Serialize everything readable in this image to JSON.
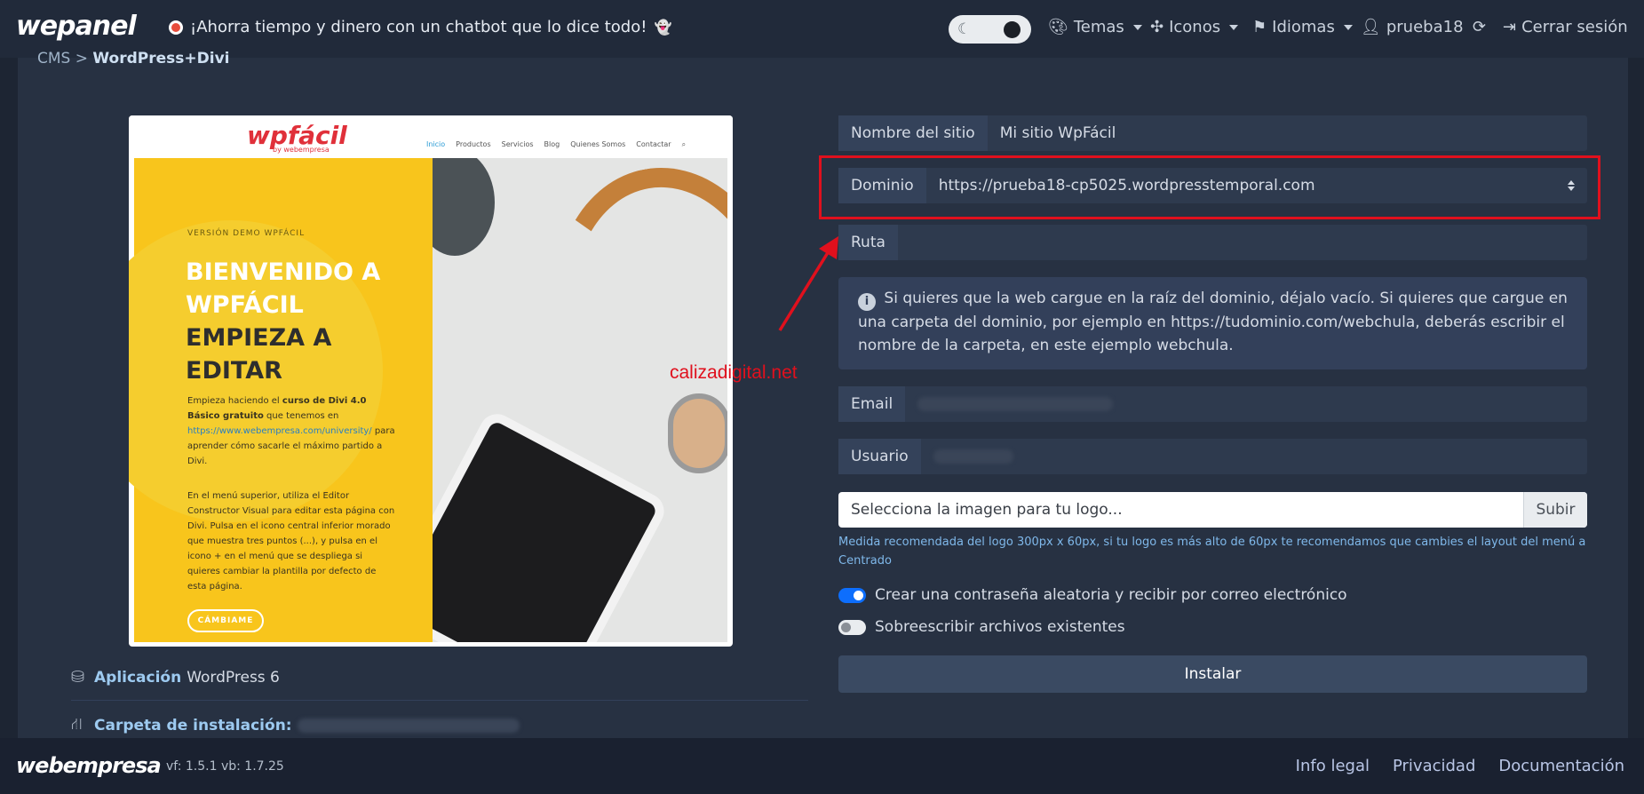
{
  "header": {
    "brand": "wepanel",
    "promo": "¡Ahorra tiempo y dinero con un chatbot que lo dice todo!",
    "promo_emoji": "👻",
    "nav": {
      "temas": "Temas",
      "iconos": "Iconos",
      "idiomas": "Idiomas",
      "user": "prueba18",
      "logout": "Cerrar sesión"
    }
  },
  "breadcrumb": {
    "section": "CMS",
    "separator": ">",
    "current": "WordPress+Divi"
  },
  "preview": {
    "logo": "wpfácil",
    "logo_sub": "by webempresa",
    "menu": [
      "Inicio",
      "Productos",
      "Servicios",
      "Blog",
      "Quienes Somos",
      "Contactar"
    ],
    "eyebrow": "VERSIÓN DEMO WPFÁCIL",
    "title_line1": "BIENVENIDO A",
    "title_line2": "WPFÁCIL",
    "title_line3": "EMPIEZA A",
    "title_line4": "EDITAR",
    "p1_a": "Empieza haciendo el",
    "p1_b": "curso de Divi 4.0 Básico gratuito",
    "p1_c": "que tenemos en",
    "p1_link": "https://www.webempresa.com/university/",
    "p1_d": "para aprender cómo sacarle el máximo partido a Divi.",
    "p2": "En el menú superior, utiliza el Editor Constructor Visual para editar esta página con Divi. Pulsa en el icono central inferior morado que muestra tres puntos (...), y pulsa en el icono + en el menú que se despliega si quieres cambiar la plantilla por defecto de esta página.",
    "button": "CÁMBIAME"
  },
  "info": {
    "app_label": "Aplicación",
    "app_value": "WordPress 6",
    "folder_label": "Carpeta de instalación:"
  },
  "form": {
    "site_name_label": "Nombre del sitio",
    "site_name_value": "Mi sitio WpFácil",
    "domain_label": "Dominio",
    "domain_value": "https://prueba18-cp5025.wordpresstemporal.com",
    "route_label": "Ruta",
    "route_value": "",
    "route_help": "Si quieres que la web cargue en la raíz del dominio, déjalo vacío. Si quieres que cargue en una carpeta del dominio, por ejemplo en https://tudominio.com/webchula, deberás escribir el nombre de la carpeta, en este ejemplo webchula.",
    "email_label": "Email",
    "user_label": "Usuario",
    "logo_placeholder": "Selecciona la imagen para tu logo...",
    "upload_label": "Subir",
    "logo_hint": "Medida recomendada del logo 300px x 60px, si tu logo es más alto de 60px te recomendamos que cambies el layout del menú a Centrado",
    "switch_password_label": "Crear una contraseña aleatoria y recibir por correo electrónico",
    "switch_password_on": true,
    "switch_overwrite_label": "Sobreescribir archivos existentes",
    "switch_overwrite_on": false,
    "install_label": "Instalar"
  },
  "annotation": {
    "watermark": "calizadigital.net",
    "highlight_color": "#e0101d"
  },
  "footer": {
    "brand": "webempresa",
    "version": "vf: 1.5.1 vb: 1.7.25",
    "links": [
      "Info legal",
      "Privacidad",
      "Documentación"
    ]
  },
  "colors": {
    "background": "#1d2533",
    "panel": "#273142",
    "accent": "#0d6efd",
    "link": "#9dcaf0"
  }
}
